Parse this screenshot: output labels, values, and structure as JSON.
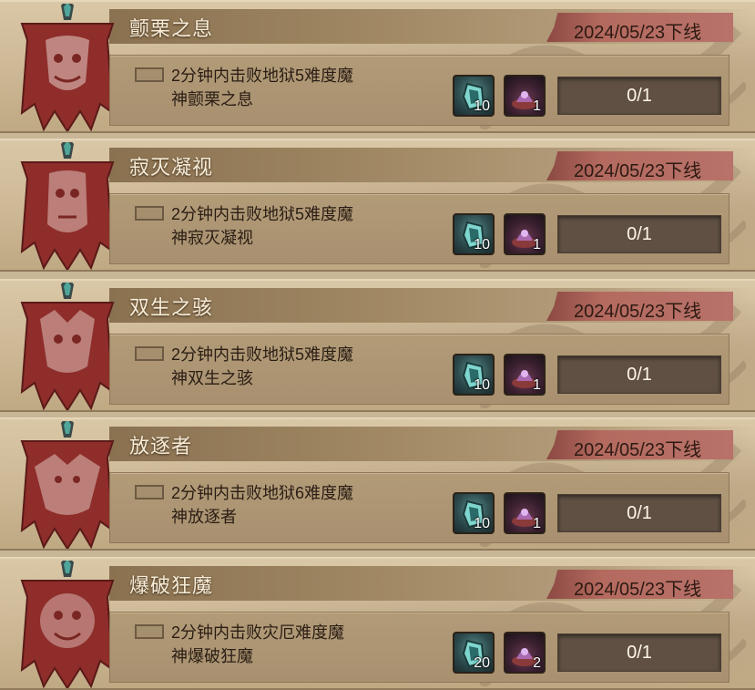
{
  "colors": {
    "parchment": "#cdb895",
    "banner_red": "#8e2d2a",
    "date_badge": "#b46a5f",
    "progress_bg": "#5f5043"
  },
  "bosses": [
    {
      "title": "颤栗之息",
      "date": "2024/05/23下线",
      "desc_line1": "2分钟内击败地狱5难度魔",
      "desc_line2": "神颤栗之息",
      "reward1_icon": "crystal-cube-icon",
      "reward1_count": "10",
      "reward2_icon": "purple-essence-icon",
      "reward2_count": "1",
      "progress": "0/1"
    },
    {
      "title": "寂灭凝视",
      "date": "2024/05/23下线",
      "desc_line1": "2分钟内击败地狱5难度魔",
      "desc_line2": "神寂灭凝视",
      "reward1_icon": "crystal-cube-icon",
      "reward1_count": "10",
      "reward2_icon": "purple-essence-icon",
      "reward2_count": "1",
      "progress": "0/1"
    },
    {
      "title": "双生之骇",
      "date": "2024/05/23下线",
      "desc_line1": "2分钟内击败地狱5难度魔",
      "desc_line2": "神双生之骇",
      "reward1_icon": "crystal-cube-icon",
      "reward1_count": "10",
      "reward2_icon": "purple-essence-icon",
      "reward2_count": "1",
      "progress": "0/1"
    },
    {
      "title": "放逐者",
      "date": "2024/05/23下线",
      "desc_line1": "2分钟内击败地狱6难度魔",
      "desc_line2": "神放逐者",
      "reward1_icon": "crystal-cube-icon",
      "reward1_count": "10",
      "reward2_icon": "purple-essence-icon",
      "reward2_count": "1",
      "progress": "0/1"
    },
    {
      "title": "爆破狂魔",
      "date": "2024/05/23下线",
      "desc_line1": "2分钟内击败灾厄难度魔",
      "desc_line2": "神爆破狂魔",
      "reward1_icon": "crystal-cube-icon",
      "reward1_count": "20",
      "reward2_icon": "purple-essence-icon",
      "reward2_count": "2",
      "progress": "0/1"
    }
  ]
}
